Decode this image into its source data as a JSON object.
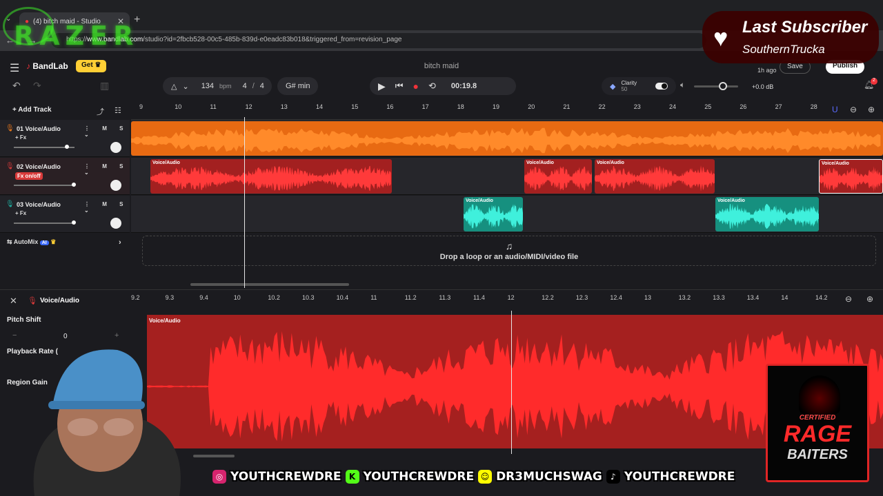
{
  "browser": {
    "tab_title": "(4) bitch maid - Studio",
    "url_prefix": "https://",
    "url_host": "www.bandlab.com",
    "url_rest": "/studio?id=2fbcb528-00c5-485b-839d-e0eadc83b018&triggered_from=revision_page",
    "overlay_brand": "RAZER"
  },
  "app": {
    "brand": "BandLab",
    "get_label": "Get",
    "project_title": "bitch maid",
    "save_label": "Save",
    "publish_label": "Publish",
    "last_saved": "1h ago"
  },
  "toolbar": {
    "tempo": "134",
    "tempo_unit": "bpm",
    "time_sig_num": "4",
    "time_sig_den": "4",
    "key": "G# min",
    "time": "00:19.8",
    "clarity_label": "Clarity",
    "clarity_value": "50",
    "master_gain": "+0.0 dB",
    "notifications": "2"
  },
  "timeline": {
    "add_track_label": "Add Track",
    "bars": [
      "9",
      "10",
      "11",
      "12",
      "13",
      "14",
      "15",
      "16",
      "17",
      "18",
      "19",
      "20",
      "21",
      "22",
      "23",
      "24",
      "25",
      "26",
      "27",
      "28"
    ]
  },
  "tracks": [
    {
      "name": "01  Voice/Audio",
      "fx": "+ Fx",
      "color": "#f07a1a"
    },
    {
      "name": "02  Voice/Audio",
      "fx": "Fx on/off",
      "color": "#d83a3a"
    },
    {
      "name": "03  Voice/Audio",
      "fx": "+ Fx",
      "color": "#1fb3a3"
    }
  ],
  "clip_label": "Voice/Audio",
  "automix": {
    "label": "AutoMix",
    "ai_badge": "AI"
  },
  "drop_zone": "Drop a loop or an audio/MIDI/video file",
  "editor": {
    "track_name": "Voice/Audio",
    "pitch_label": "Pitch Shift",
    "pitch_value": "0",
    "rate_label": "Playback Rate (",
    "gain_label": "Region Gain",
    "clip_label": "Voice/Audio",
    "ruler": [
      "9.2",
      "9.3",
      "9.4",
      "10",
      "10.2",
      "10.3",
      "10.4",
      "11",
      "11.2",
      "11.3",
      "11.4",
      "12",
      "12.2",
      "12.3",
      "12.4",
      "13",
      "13.2",
      "13.3",
      "13.4",
      "14",
      "14.2"
    ]
  },
  "overlay": {
    "sub_title": "Last Subscriber",
    "sub_name": "SouthernTrucka",
    "socials": [
      "YOUTHCREWDRE",
      "YOUTHCREWDRE",
      "DR3MUCHSWAG",
      "YOUTHCREWDRE"
    ],
    "badge_top": "CERTIFIED",
    "badge_mid": "RAGE",
    "badge_bot": "BAITERS"
  }
}
